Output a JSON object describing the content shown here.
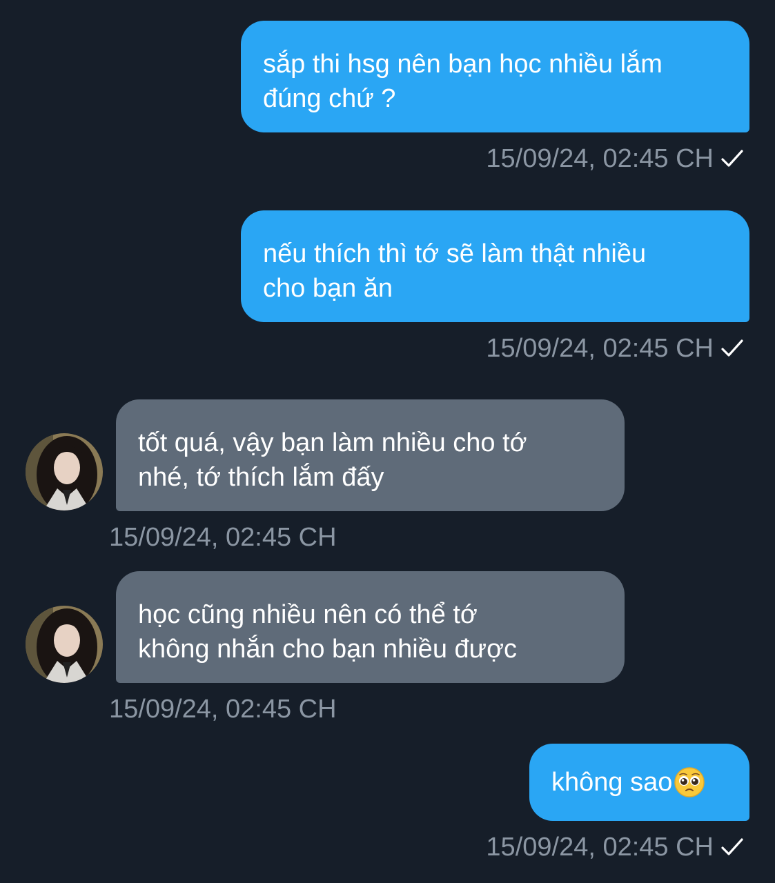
{
  "messages": [
    {
      "direction": "outgoing",
      "text": "sắp thi hsg nên bạn học nhiều lắm\nđúng chứ ?",
      "timestamp": "15/09/24, 02:45 CH",
      "status_icon": "single-check-icon"
    },
    {
      "direction": "outgoing",
      "text": "nếu thích thì tớ sẽ làm thật nhiều\ncho bạn ăn",
      "timestamp": "15/09/24, 02:45 CH",
      "status_icon": "single-check-icon"
    },
    {
      "direction": "incoming",
      "text": "tốt quá, vậy bạn làm nhiều cho tớ\nnhé, tớ thích lắm đấy",
      "timestamp": "15/09/24, 02:45 CH",
      "avatar_icon": "user-avatar"
    },
    {
      "direction": "incoming",
      "text": "học cũng nhiều nên có thể tớ\nkhông nhắn cho bạn nhiều được",
      "timestamp": "15/09/24, 02:45 CH",
      "avatar_icon": "user-avatar"
    },
    {
      "direction": "outgoing",
      "text": "không sao",
      "emoji": "pleading-face-emoji",
      "timestamp": "15/09/24, 02:45 CH",
      "status_icon": "single-check-icon"
    }
  ],
  "colors": {
    "background": "#161e29",
    "outgoing_bubble": "#2aa6f4",
    "incoming_bubble": "#5f6b79",
    "message_text": "#ffffff",
    "timestamp_text": "#8b96a3"
  }
}
